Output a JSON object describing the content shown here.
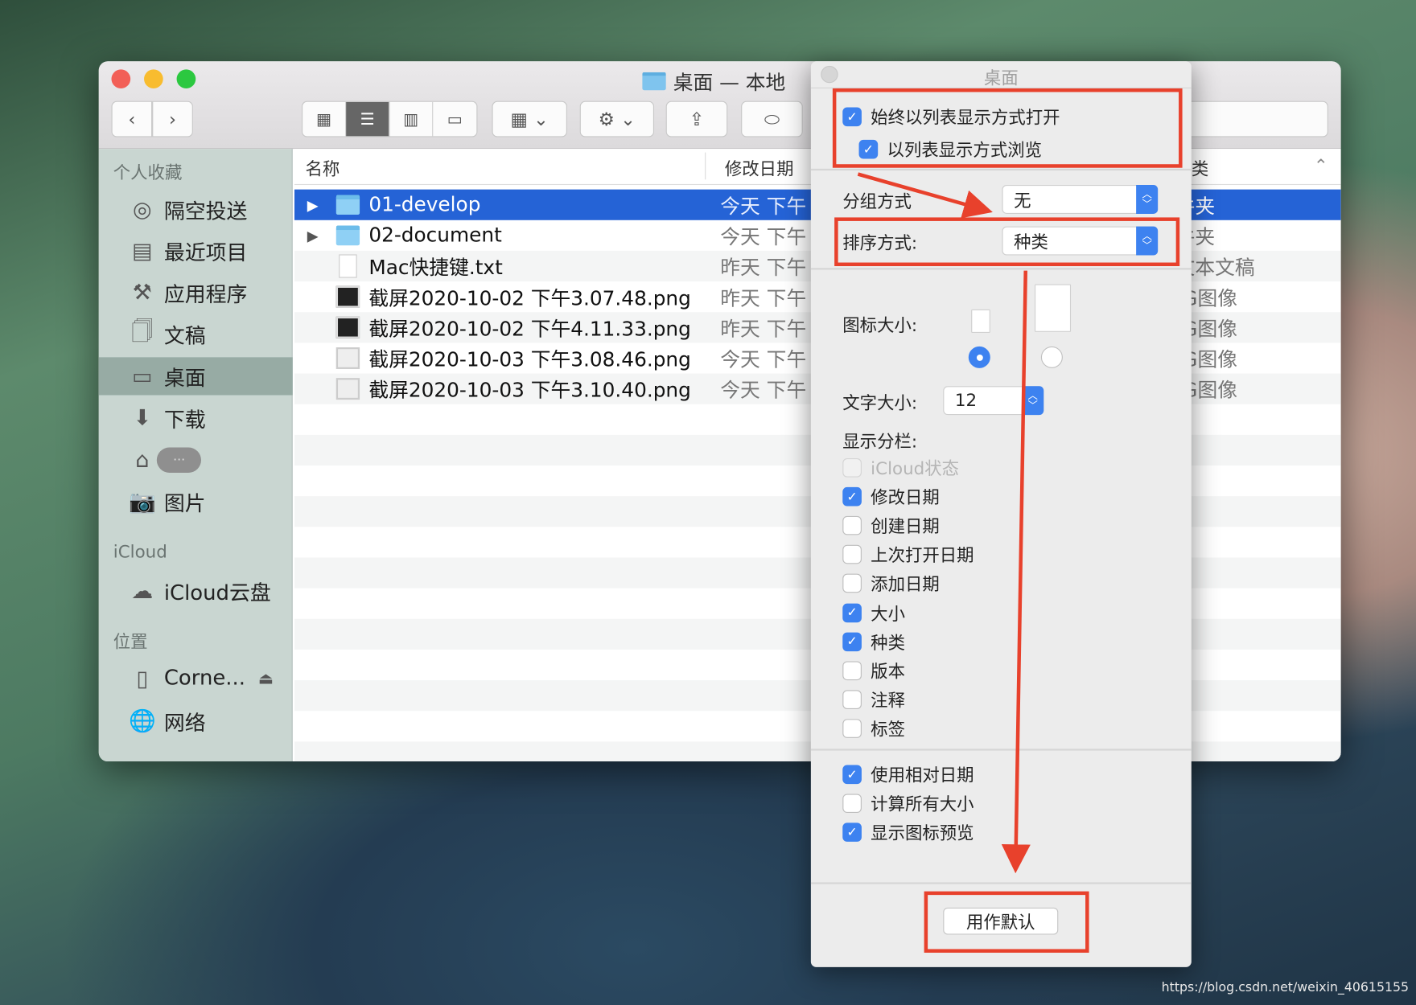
{
  "window": {
    "title": "桌面 — 本地"
  },
  "toolbar": {
    "back_icon": "chevron-left",
    "forward_icon": "chevron-right",
    "views": [
      "icon-view",
      "list-view",
      "column-view",
      "gallery-view"
    ],
    "active_view": "list-view"
  },
  "sidebar": {
    "sections": [
      {
        "header": "个人收藏",
        "items": [
          {
            "label": "隔空投送",
            "icon": "airdrop"
          },
          {
            "label": "最近项目",
            "icon": "recents"
          },
          {
            "label": "应用程序",
            "icon": "applications"
          },
          {
            "label": "文稿",
            "icon": "documents"
          },
          {
            "label": "桌面",
            "icon": "desktop",
            "selected": true
          },
          {
            "label": "下载",
            "icon": "downloads"
          },
          {
            "label": "···",
            "icon": "home"
          },
          {
            "label": "图片",
            "icon": "pictures"
          }
        ]
      },
      {
        "header": "iCloud",
        "items": [
          {
            "label": "iCloud云盘",
            "icon": "cloud"
          }
        ]
      },
      {
        "header": "位置",
        "items": [
          {
            "label": "Corne...",
            "icon": "disk"
          },
          {
            "label": "网络",
            "icon": "network"
          }
        ]
      }
    ]
  },
  "list": {
    "columns": {
      "name": "名称",
      "date": "修改日期",
      "kind": "类"
    },
    "rows": [
      {
        "name": "01-develop",
        "date": "今天 下午",
        "kind": "文件夹",
        "type": "folder",
        "selected": true
      },
      {
        "name": "02-document",
        "date": "今天 下午",
        "kind": "文件夹",
        "type": "folder"
      },
      {
        "name": "Mac快捷键.txt",
        "date": "昨天 下午",
        "kind": "纯文本文稿",
        "type": "txt"
      },
      {
        "name": "截屏2020-10-02 下午3.07.48.png",
        "date": "昨天 下午",
        "kind": "PNG图像",
        "type": "png-dark"
      },
      {
        "name": "截屏2020-10-02 下午4.11.33.png",
        "date": "昨天 下午",
        "kind": "PNG图像",
        "type": "png-dark"
      },
      {
        "name": "截屏2020-10-03 下午3.08.46.png",
        "date": "今天 下午",
        "kind": "PNG图像",
        "type": "png-light"
      },
      {
        "name": "截屏2020-10-03 下午3.10.40.png",
        "date": "今天 下午",
        "kind": "PNG图像",
        "type": "png-light"
      }
    ]
  },
  "dialog": {
    "title": "桌面",
    "always_open_list": {
      "label": "始终以列表显示方式打开",
      "checked": true
    },
    "browse_list": {
      "label": "以列表显示方式浏览",
      "checked": true
    },
    "group_by": {
      "label": "分组方式",
      "value": "无"
    },
    "sort_by": {
      "label": "排序方式:",
      "value": "种类"
    },
    "icon_size": {
      "label": "图标大小:",
      "selected": "small"
    },
    "text_size": {
      "label": "文字大小:",
      "value": "12"
    },
    "columns_label": "显示分栏:",
    "columns": [
      {
        "label": "iCloud状态",
        "checked": false,
        "disabled": true
      },
      {
        "label": "修改日期",
        "checked": true
      },
      {
        "label": "创建日期",
        "checked": false
      },
      {
        "label": "上次打开日期",
        "checked": false
      },
      {
        "label": "添加日期",
        "checked": false
      },
      {
        "label": "大小",
        "checked": true
      },
      {
        "label": "种类",
        "checked": true
      },
      {
        "label": "版本",
        "checked": false
      },
      {
        "label": "注释",
        "checked": false
      },
      {
        "label": "标签",
        "checked": false
      }
    ],
    "options": [
      {
        "label": "使用相对日期",
        "checked": true
      },
      {
        "label": "计算所有大小",
        "checked": false
      },
      {
        "label": "显示图标预览",
        "checked": true
      }
    ],
    "default_button": "用作默认"
  },
  "annotation_color": "#e8412c",
  "accent_color": "#2563d6",
  "watermark": "https://blog.csdn.net/weixin_40615155"
}
